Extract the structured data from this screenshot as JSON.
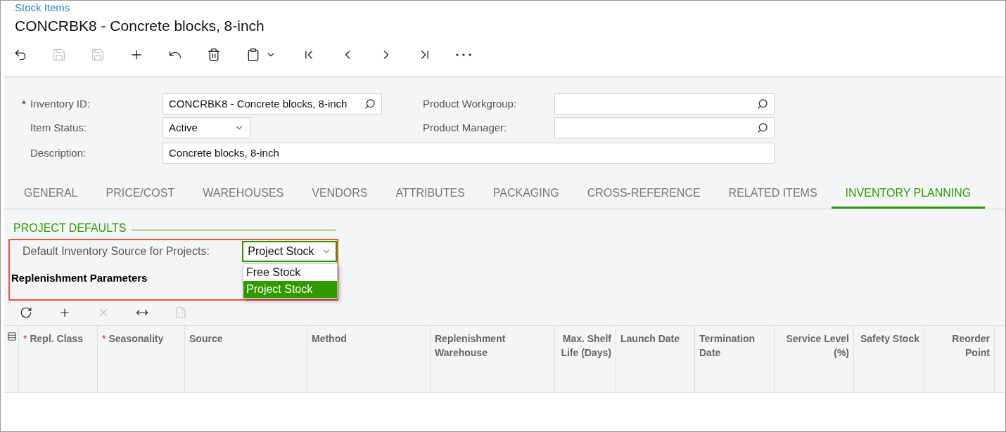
{
  "breadcrumb": "Stock Items",
  "title": "CONCRBK8 - Concrete blocks, 8-inch",
  "toolbar": [
    {
      "kind": "back",
      "disabled": false
    },
    {
      "kind": "save-close",
      "disabled": true
    },
    {
      "kind": "save",
      "disabled": true
    },
    {
      "kind": "add",
      "disabled": false
    },
    {
      "kind": "undo",
      "disabled": false
    },
    {
      "kind": "delete",
      "disabled": false
    },
    {
      "kind": "clipboard",
      "disabled": false
    },
    {
      "kind": "first",
      "disabled": false
    },
    {
      "kind": "prev",
      "disabled": false
    },
    {
      "kind": "next",
      "disabled": false
    },
    {
      "kind": "last",
      "disabled": false
    },
    {
      "kind": "more",
      "disabled": false
    }
  ],
  "form": {
    "inventory_id": {
      "label": "Inventory ID:",
      "required_mark": "*",
      "value": "CONCRBK8 - Concrete blocks, 8-inch"
    },
    "item_status": {
      "label": "Item Status:",
      "value": "Active"
    },
    "description": {
      "label": "Description:",
      "value": "Concrete blocks, 8-inch"
    },
    "product_workgroup": {
      "label": "Product Workgroup:"
    },
    "product_manager": {
      "label": "Product Manager:"
    }
  },
  "tabs": [
    {
      "label": "GENERAL",
      "selected": false
    },
    {
      "label": "PRICE/COST",
      "selected": false
    },
    {
      "label": "WAREHOUSES",
      "selected": false
    },
    {
      "label": "VENDORS",
      "selected": false
    },
    {
      "label": "ATTRIBUTES",
      "selected": false
    },
    {
      "label": "PACKAGING",
      "selected": false
    },
    {
      "label": "CROSS-REFERENCE",
      "selected": false
    },
    {
      "label": "RELATED ITEMS",
      "selected": false
    },
    {
      "label": "INVENTORY PLANNING",
      "selected": true
    }
  ],
  "project_defaults": {
    "heading": "PROJECT DEFAULTS",
    "source_label": "Default Inventory Source for Projects:",
    "source_value": "Project Stock",
    "options": [
      {
        "label": "Free Stock",
        "selected": false
      },
      {
        "label": "Project Stock",
        "selected": true
      }
    ]
  },
  "replenishment": {
    "heading": "Replenishment Parameters",
    "toolbar": [
      {
        "kind": "refresh",
        "disabled": false
      },
      {
        "kind": "add",
        "disabled": false
      },
      {
        "kind": "delete",
        "disabled": true
      },
      {
        "kind": "fit",
        "disabled": false
      },
      {
        "kind": "export",
        "disabled": true
      }
    ],
    "columns": [
      {
        "label": "Repl. Class",
        "required_mark": "*",
        "kind": "text"
      },
      {
        "label": "Seasonality",
        "required_mark": "*",
        "kind": "text"
      },
      {
        "label": "Source",
        "kind": "text"
      },
      {
        "label": "Method",
        "kind": "text"
      },
      {
        "label": "Replenishment Warehouse",
        "kind": "text"
      },
      {
        "label": "Max. Shelf Life (Days)",
        "kind": "number"
      },
      {
        "label": "Launch Date",
        "kind": "text"
      },
      {
        "label": "Termination Date",
        "kind": "text"
      },
      {
        "label": "Service Level (%)",
        "kind": "number"
      },
      {
        "label": "Safety Stock",
        "kind": "number"
      },
      {
        "label": "Reorder Point",
        "kind": "number"
      }
    ]
  }
}
